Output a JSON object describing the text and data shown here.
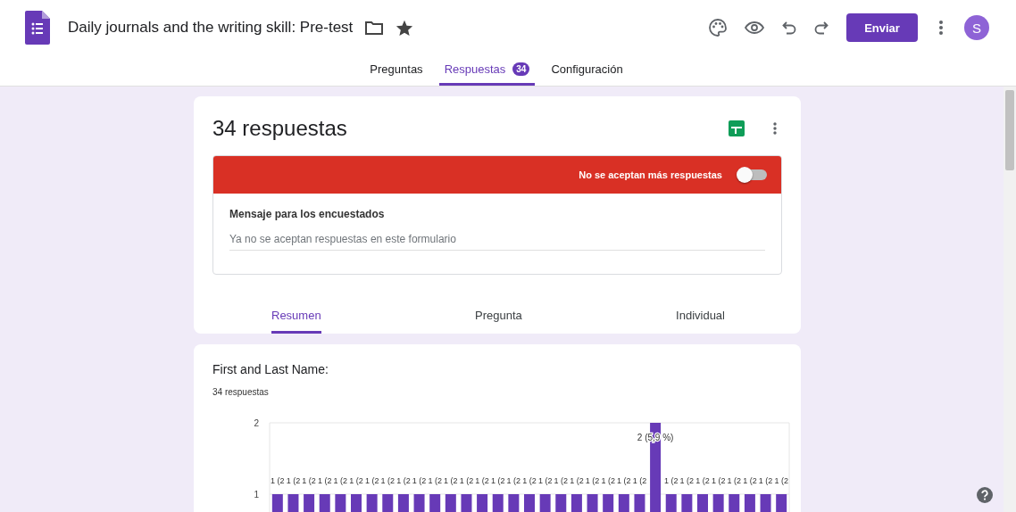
{
  "header": {
    "title": "Daily journals and the writing skill: Pre-test",
    "send_button": "Enviar",
    "avatar": "S"
  },
  "tabs": [
    {
      "label": "Preguntas",
      "selected": false
    },
    {
      "label": "Respuestas",
      "selected": true,
      "badge": "34"
    },
    {
      "label": "Configuración",
      "selected": false
    }
  ],
  "responses_card": {
    "title": "34 respuestas",
    "banner": {
      "label": "No se aceptan más respuestas",
      "on": false
    },
    "message": {
      "label": "Mensaje para los encuestados",
      "placeholder": "Ya no se aceptan respuestas en este formulario"
    },
    "view_tabs": [
      {
        "label": "Resumen",
        "selected": true
      },
      {
        "label": "Pregunta",
        "selected": false
      },
      {
        "label": "Individual",
        "selected": false
      }
    ]
  },
  "question_card": {
    "title": "First and Last Name:",
    "count": "34 respuestas",
    "chart_data": {
      "type": "bar",
      "ylim": [
        0,
        2
      ],
      "yticks": [
        1,
        2
      ],
      "series": [
        {
          "color": "#673ab7",
          "values": [
            1,
            1,
            1,
            1,
            1,
            1,
            1,
            1,
            1,
            1,
            1,
            1,
            1,
            1,
            1,
            1,
            1,
            1,
            1,
            1,
            1,
            1,
            1,
            1,
            2,
            1,
            1,
            1,
            1,
            1,
            1,
            1,
            1
          ]
        }
      ],
      "value_labels": [
        "1 (2",
        "1 (2",
        "1 (2",
        "1 (2",
        "1 (2",
        "1 (2",
        "1 (2",
        "1 (2",
        "1 (2",
        "1 (2",
        "1 (2",
        "1 (2",
        "1 (2",
        "1 (2",
        "1 (2",
        "1 (2",
        "1 (2",
        "1 (2",
        "1 (2",
        "1 (2",
        "1 (2",
        "1 (2",
        "1 (2",
        "1 (2",
        "2 (5,9 %)",
        "1 (2",
        "1 (2",
        "1 (2",
        "1 (2",
        "1 (2",
        "1 (2",
        "1 (2",
        "1 (2"
      ]
    }
  }
}
